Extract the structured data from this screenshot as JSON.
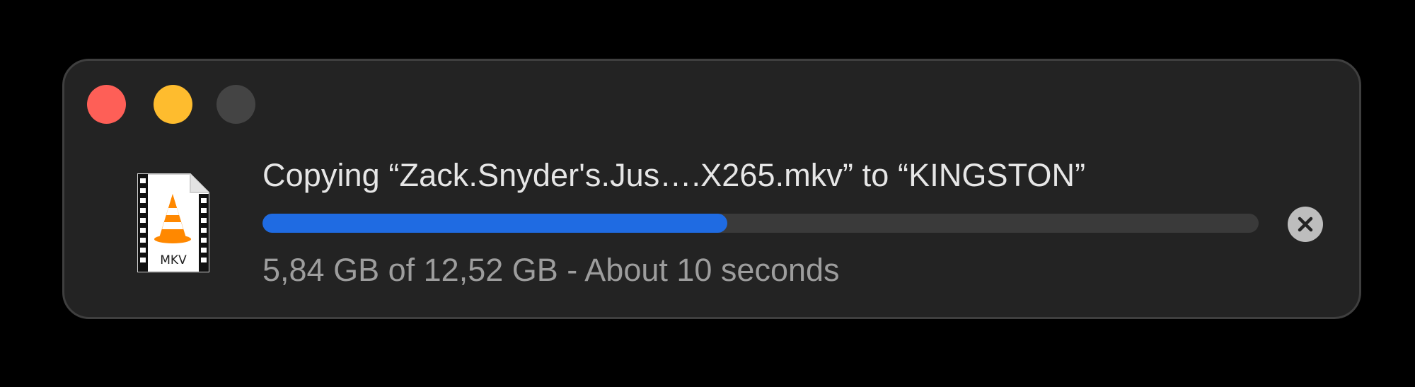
{
  "dialog": {
    "title": "Copying “Zack.Snyder's.Jus….X265.mkv” to “KINGSTON”",
    "status": "5,84 GB of 12,52 GB - About 10 seconds",
    "progress_fraction": 0.4665,
    "file_icon": {
      "icon": "vlc-cone-film-icon",
      "label": "MKV"
    }
  },
  "window_controls": {
    "close_icon": "close-circle",
    "minimize_icon": "minimize-circle",
    "zoom_icon": "zoom-circle-disabled"
  },
  "colors": {
    "window_bg": "#232323",
    "progress_fill": "#1f6be2",
    "progress_track": "#3a3a3a",
    "close": "#fe5f57",
    "minimize": "#febc2e",
    "zoom_disabled": "#444444"
  }
}
